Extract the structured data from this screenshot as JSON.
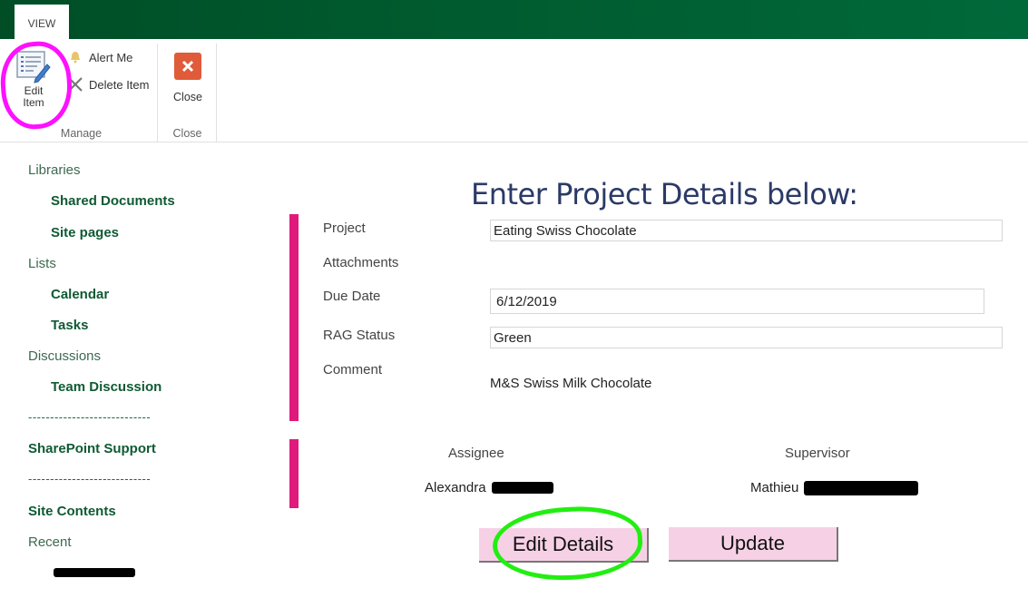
{
  "ribbon": {
    "tabs": [
      {
        "label": "VIEW",
        "active": true
      }
    ],
    "groups": {
      "manage": {
        "label": "Manage",
        "edit_item": {
          "label_line1": "Edit",
          "label_line2": "Item",
          "icon": "edit-list-icon"
        },
        "alert_me": {
          "label": "Alert Me",
          "icon": "bell-icon"
        },
        "delete_item": {
          "label": "Delete Item",
          "icon": "x-cross-icon"
        }
      },
      "close": {
        "label": "Close",
        "close_button": {
          "label": "Close",
          "icon": "close-square-icon"
        }
      }
    }
  },
  "nav": {
    "libraries": {
      "label": "Libraries",
      "items": [
        "Shared Documents",
        "Site pages"
      ]
    },
    "lists": {
      "label": "Lists",
      "items": [
        "Calendar",
        "Tasks"
      ]
    },
    "discussions": {
      "label": "Discussions",
      "items": [
        "Team Discussion"
      ]
    },
    "separator": "----------------------------",
    "sharepoint_support": "SharePoint Support",
    "site_contents": "Site Contents",
    "recent": {
      "label": "Recent"
    }
  },
  "form": {
    "title": "Enter Project Details below:",
    "fields": {
      "project": {
        "label": "Project",
        "value": "Eating Swiss Chocolate"
      },
      "attachments": {
        "label": "Attachments"
      },
      "due_date": {
        "label": "Due Date",
        "value": "6/12/2019"
      },
      "rag_status": {
        "label": "RAG Status",
        "value": "Green"
      },
      "comment": {
        "label": "Comment",
        "value": "M&S Swiss Milk Chocolate"
      }
    },
    "assignee": {
      "label": "Assignee",
      "first_name": "Alexandra"
    },
    "supervisor": {
      "label": "Supervisor",
      "first_name": "Mathieu"
    },
    "buttons": {
      "edit_details": "Edit Details",
      "update": "Update"
    }
  },
  "colors": {
    "header_green": "#005a2e",
    "nav_green": "#0f5a33",
    "accent_pink": "#e0197d",
    "button_pink": "#f6d1e6",
    "title_blue": "#2b3a67",
    "annotation_magenta": "#ff10ff",
    "annotation_green": "#22ee11"
  }
}
